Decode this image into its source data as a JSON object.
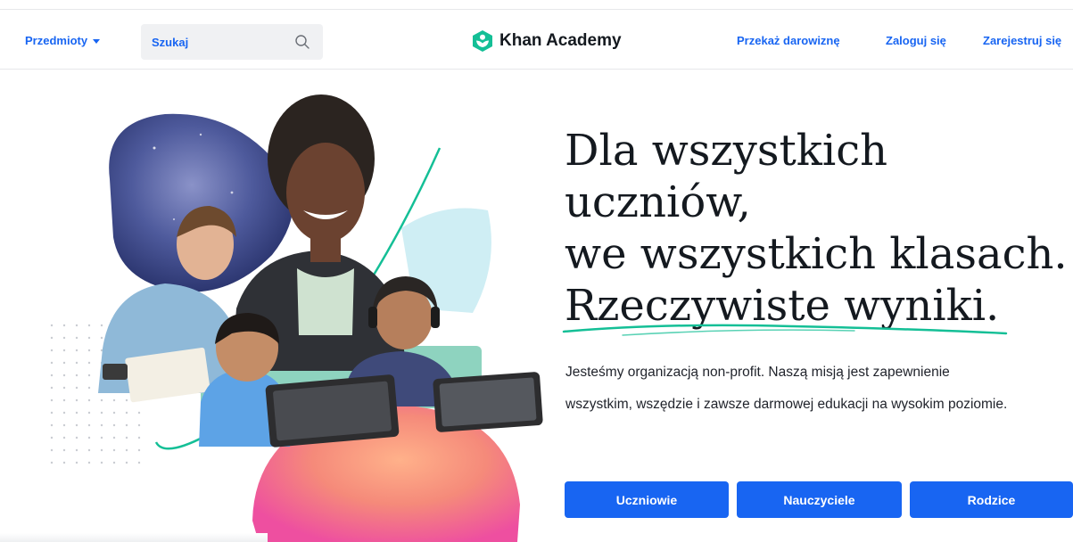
{
  "nav": {
    "subjects_label": "Przedmioty",
    "search_placeholder": "Szukaj",
    "logo_text": "Khan Academy",
    "donate_label": "Przekaż darowiznę",
    "login_label": "Zaloguj się",
    "signup_label": "Zarejestruj się"
  },
  "hero": {
    "headline_lines": [
      "Dla wszystkich",
      "uczniów,",
      "we wszystkich klasach.",
      "Rzeczywiste wyniki."
    ],
    "description_lines": [
      "Jesteśmy organizacją non-profit. Naszą misją jest zapewnienie",
      "wszystkim, wszędzie i zawsze darmowej edukacji na wysokim poziomie."
    ],
    "buttons": {
      "students": "Uczniowie",
      "teachers": "Nauczyciele",
      "parents": "Rodzice"
    }
  },
  "icons": {
    "search": "search-icon",
    "logo": "khan-academy-logo-icon",
    "dropdown": "chevron-down-icon"
  },
  "colors": {
    "brand_blue": "#1865f2",
    "brand_green": "#14bf96",
    "text_dark": "#14191f"
  }
}
